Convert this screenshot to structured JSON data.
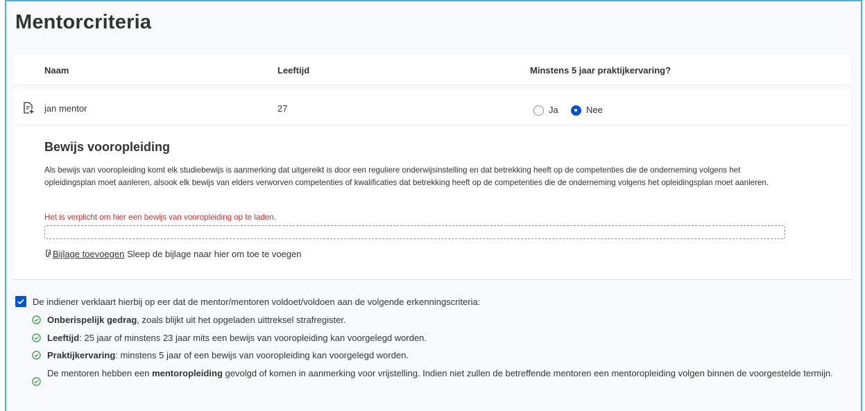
{
  "title": "Mentorcriteria",
  "table": {
    "headers": {
      "name": "Naam",
      "age": "Leeftijd",
      "experience": "Minstens 5 jaar praktijkervaring?"
    },
    "row": {
      "name": "jan mentor",
      "age": "27",
      "options": {
        "yes": "Ja",
        "no": "Nee"
      },
      "selected": "no"
    }
  },
  "proof": {
    "heading": "Bewijs vooropleiding",
    "description": "Als bewijs van vooropleiding komt elk studiebewijs is aanmerking dat uitgereikt is door een reguliere onderwijsinstelling en dat betrekking heeft op de competenties die de onderneming volgens het opleidingsplan moet aanleren, alsook elk bewijs van elders verworven competenties of kwalificaties dat betrekking heeft op de competenties die de onderneming volgens het opleidingsplan moet aanleren.",
    "error": "Het is verplicht om hier een bewijs van vooropleiding op te laden.",
    "attach_link": "Bijlage toevoegen",
    "attach_hint": "Sleep de bijlage naar hier om toe te voegen"
  },
  "declaration": {
    "checked": true,
    "text": "De indiener verklaart hierbij op eer dat de mentor/mentoren voldoet/voldoen aan de volgende erkenningscriteria:",
    "criteria": [
      {
        "bold": "Onberispelijk gedrag",
        "rest": ", zoals blijkt uit het opgeladen uittreksel strafregister."
      },
      {
        "bold": "Leeftijd",
        "rest": ": 25 jaar of minstens 23 jaar mits een bewijs van vooropleiding kan voorgelegd worden."
      },
      {
        "bold": "Praktijkervaring",
        "rest": ": minstens 5 jaar of een bewijs van vooropleiding kan voorgelegd worden."
      },
      {
        "pre": "De mentoren hebben een ",
        "bold": "mentoropleiding",
        "rest": " gevolgd of komen in aanmerking voor vrijstelling. Indien niet zullen de betreffende mentoren een mentoropleiding volgen binnen de voorgestelde termijn."
      }
    ]
  },
  "colors": {
    "accent": "#0055cc",
    "border": "#4fb1cf",
    "error": "#d12d2d",
    "success": "#2e9c3c"
  }
}
